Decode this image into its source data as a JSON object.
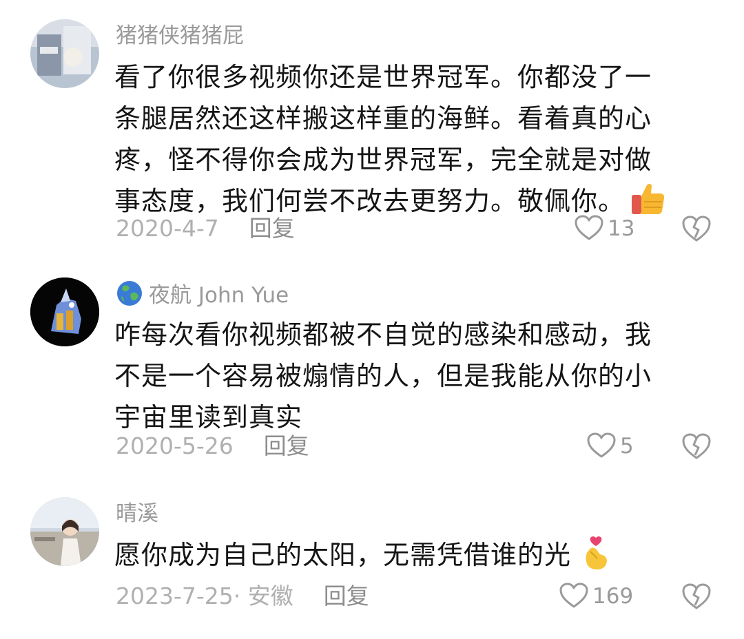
{
  "comments": [
    {
      "username": "猪猪侠猪猪屁",
      "lines": [
        "看了你很多视频你还是世界冠军。你都没了一",
        "条腿居然还这样搬这样重的海鲜。看着真的心",
        "疼，怪不得你会成为世界冠军，完全就是对做",
        "事态度，我们何尝不改去更努力。敬佩你。"
      ],
      "emoji": "thumbs-up-icon",
      "date": "2020-4-7",
      "reply": "回复",
      "likes": "13"
    },
    {
      "username": "夜航 John Yue",
      "lines": [
        "咋每次看你视频都被不自觉的感染和感动，我",
        "不是一个容易被煽情的人，但是我能从你的小",
        "宇宙里读到真实"
      ],
      "date": "2020-5-26",
      "reply": "回复",
      "likes": "5"
    },
    {
      "username": "晴溪",
      "lines": [
        "愿你成为自己的太阳，无需凭借谁的光"
      ],
      "emoji": "finger-heart-icon",
      "date": "2023-7-25· 安徽",
      "reply": "回复",
      "likes": "169"
    }
  ],
  "colors": {
    "text": "#151515",
    "meta": "#b0b0b0",
    "username": "#9a9a9a"
  }
}
